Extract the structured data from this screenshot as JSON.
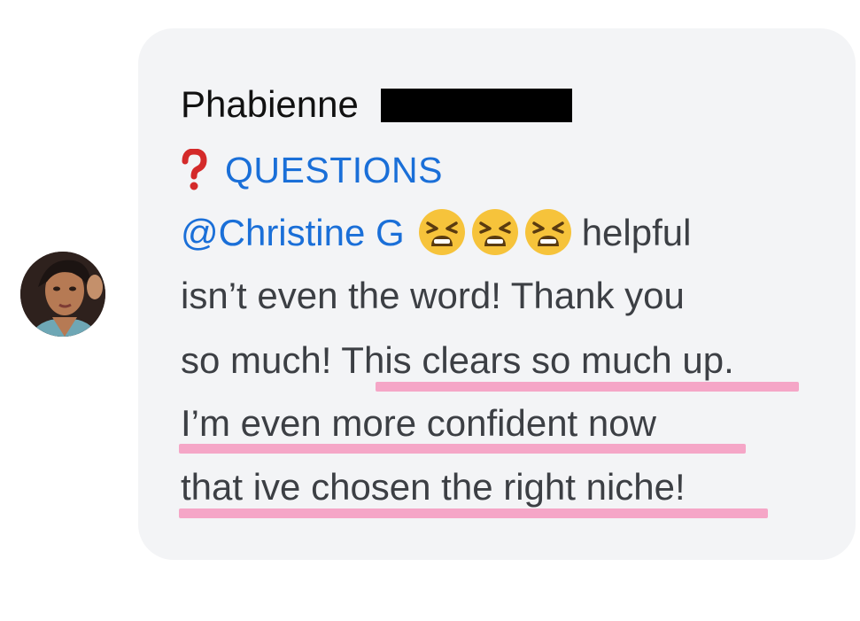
{
  "message": {
    "sender_name": "Phabienne",
    "tag_label": "QUESTIONS",
    "tag_icon": "red-question-mark-icon",
    "mention": "@Christine G",
    "emoji_icon": "tired-face-emoji-icon",
    "line1_after_emoji": "helpful",
    "line2": "isn’t even the word! Thank you",
    "line3": "so much! This clears so much up.",
    "line4": "I’m even more confident now",
    "line5": "that ive chosen the right niche!"
  },
  "colors": {
    "bubble": "#f3f4f6",
    "mention": "#1a6fd8",
    "highlight": "#f5a6c7",
    "text": "#3c3f44"
  }
}
